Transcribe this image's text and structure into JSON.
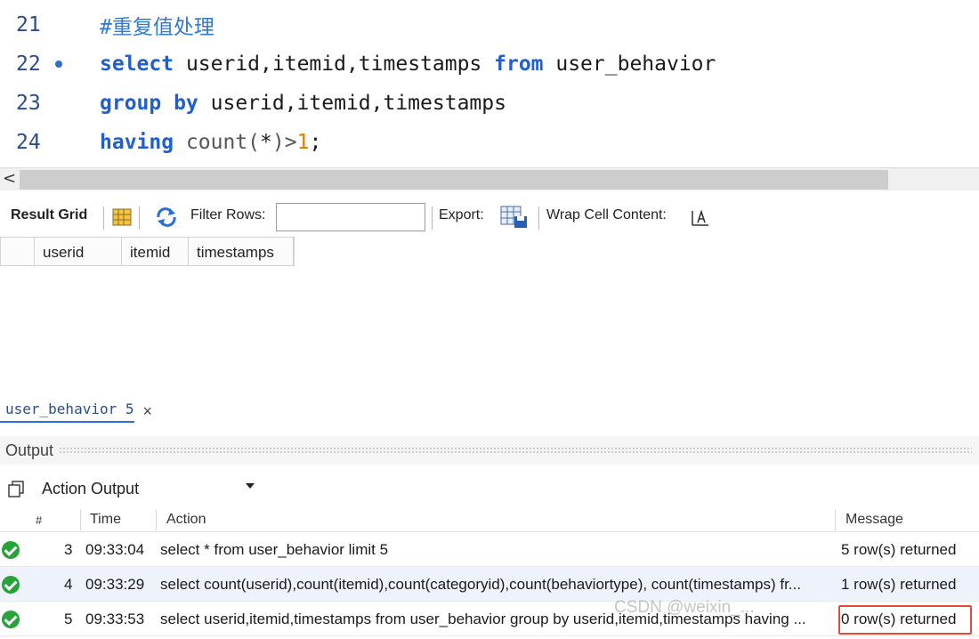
{
  "editor": {
    "lines": [
      {
        "num": "21",
        "comment": "#重复值处理"
      },
      {
        "num": "22",
        "kw1": "select",
        "t1": " userid,itemid,timestamps ",
        "kw2": "from",
        "t2": " user_behavior"
      },
      {
        "num": "23",
        "kw1": "group by",
        "t1": " userid,itemid,timestamps"
      },
      {
        "num": "24",
        "kw1": "having",
        "fn": " count(",
        "t1": "*",
        "fn2": ")>",
        "num_lit": "1",
        "t2": ";"
      }
    ],
    "scroll_left_arrow": "<"
  },
  "toolbar": {
    "result_grid": "Result Grid",
    "filter_rows": "Filter Rows:",
    "filter_value": "",
    "export": "Export:",
    "wrap_cell": "Wrap Cell Content:"
  },
  "grid": {
    "columns": [
      "userid",
      "itemid",
      "timestamps"
    ]
  },
  "tab": {
    "label": "user_behavior 5",
    "close": "×"
  },
  "output": {
    "title": "Output",
    "selected": "Action Output",
    "headers": {
      "num": "#",
      "time": "Time",
      "action": "Action",
      "message": "Message"
    },
    "rows": [
      {
        "num": "3",
        "time": "09:33:04",
        "action": "select * from user_behavior limit 5",
        "message": "5 row(s) returned"
      },
      {
        "num": "4",
        "time": "09:33:29",
        "action": "select count(userid),count(itemid),count(categoryid),count(behaviortype), count(timestamps) fr...",
        "message": "1 row(s) returned"
      },
      {
        "num": "5",
        "time": "09:33:53",
        "action": "select userid,itemid,timestamps from user_behavior group by userid,itemid,timestamps having ...",
        "message": "0 row(s) returned"
      }
    ]
  },
  "watermark": "CSDN @weixin_..."
}
